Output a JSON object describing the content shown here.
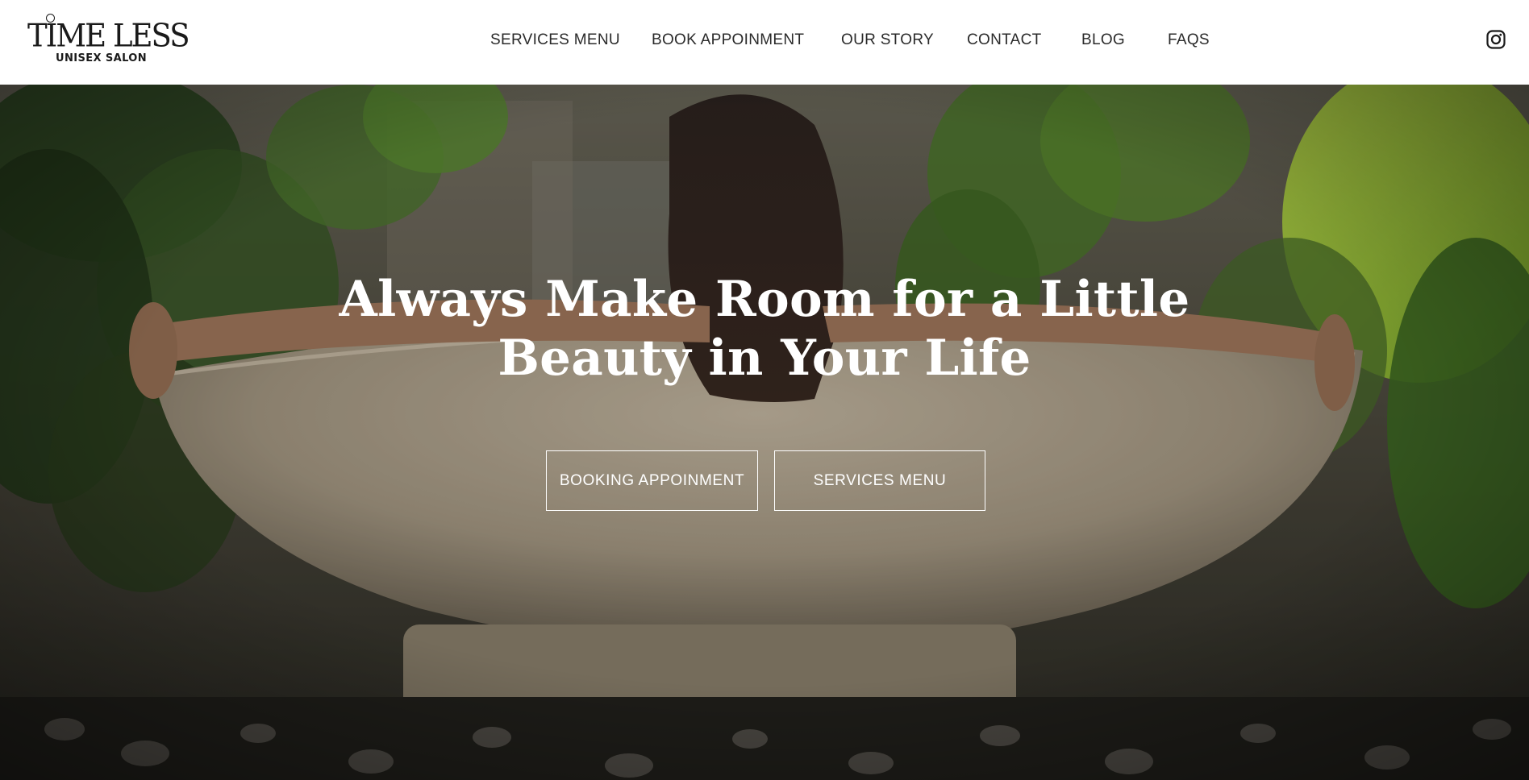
{
  "header": {
    "logo": {
      "title": "TIME LESS",
      "subtitle": "UNISEX SALON"
    },
    "nav": [
      {
        "label": "SERVICES MENU"
      },
      {
        "label": "BOOK APPOINMENT"
      },
      {
        "label": "OUR STORY"
      },
      {
        "label": "CONTACT"
      },
      {
        "label": "BLOG"
      },
      {
        "label": "FAQS"
      }
    ],
    "social_icon": "instagram-icon"
  },
  "hero": {
    "title_line1": "Always Make Room for a Little",
    "title_line2": "Beauty in Your Life",
    "buttons": {
      "booking": "BOOKING APPOINMENT",
      "services": "SERVICES MENU"
    }
  },
  "colors": {
    "text_dark": "#2a2a2a",
    "hero_text": "#ffffff",
    "header_bg": "#ffffff"
  }
}
